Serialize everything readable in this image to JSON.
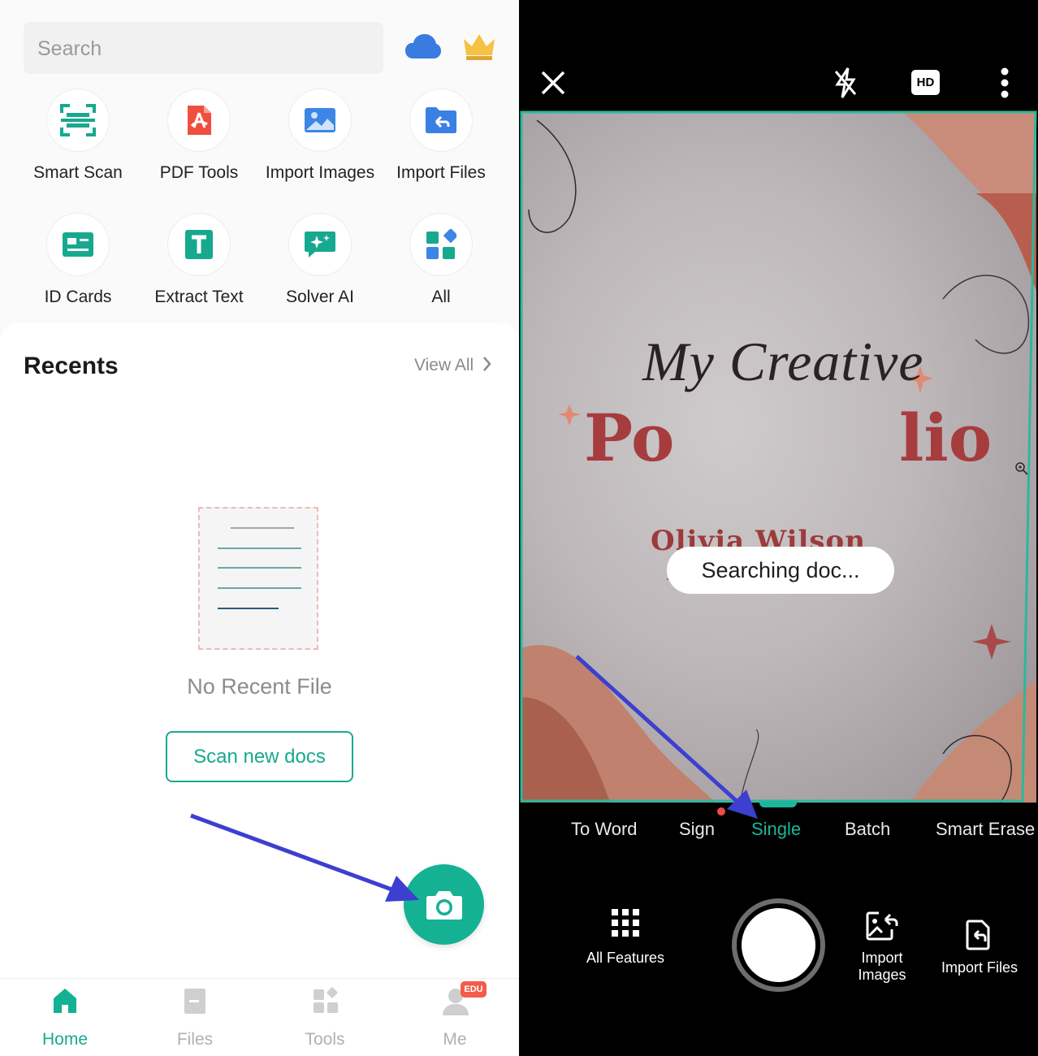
{
  "home": {
    "search_placeholder": "Search",
    "icons": {
      "cloud": "cloud-icon",
      "crown": "crown-icon"
    },
    "tools": [
      {
        "label": "Smart Scan",
        "icon": "smart-scan-icon"
      },
      {
        "label": "PDF Tools",
        "icon": "pdf-icon"
      },
      {
        "label": "Import Images",
        "icon": "image-icon"
      },
      {
        "label": "Import Files",
        "icon": "folder-import-icon"
      },
      {
        "label": "ID Cards",
        "icon": "id-card-icon"
      },
      {
        "label": "Extract Text",
        "icon": "text-icon"
      },
      {
        "label": "Solver AI",
        "icon": "solver-ai-icon"
      },
      {
        "label": "All",
        "icon": "grid-icon"
      }
    ],
    "recents": {
      "title": "Recents",
      "view_all": "View All",
      "empty_text": "No Recent File",
      "scan_button": "Scan new docs"
    },
    "bottom_nav": [
      {
        "label": "Home",
        "active": true
      },
      {
        "label": "Files",
        "active": false
      },
      {
        "label": "Tools",
        "active": false
      },
      {
        "label": "Me",
        "active": false
      }
    ],
    "me_badge": "EDU",
    "colors": {
      "accent": "#14b193",
      "brand_text": "#17a98f",
      "badge": "#f25c4a"
    }
  },
  "camera": {
    "hd_label": "HD",
    "document": {
      "line1": "My Creative",
      "line2_start": "Po",
      "line2_end": "lio",
      "name": "Olivia Wilson"
    },
    "status": "Searching doc...",
    "modes": [
      "To Word",
      "Sign",
      "Single",
      "Batch",
      "Smart Erase"
    ],
    "active_mode": "Single",
    "actions": {
      "all_features": "All Features",
      "import_images": "Import Images",
      "import_files": "Import Files"
    },
    "colors": {
      "accent": "#1bb79a",
      "frame": "#2ab89c"
    }
  }
}
